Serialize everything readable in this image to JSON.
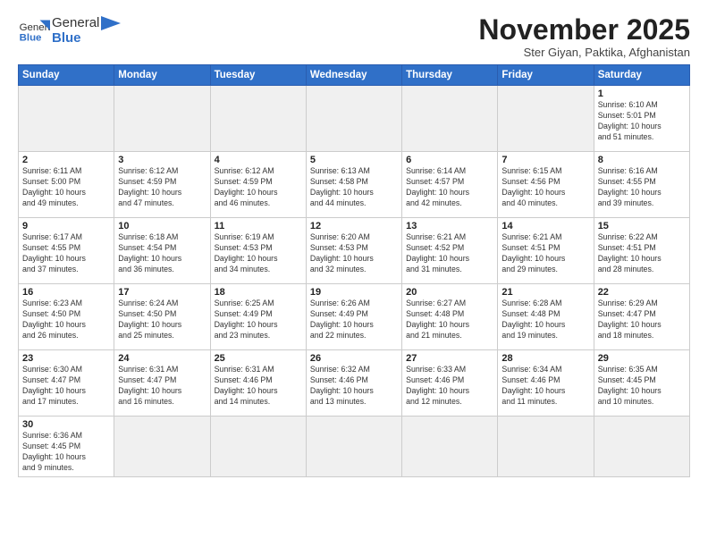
{
  "logo": {
    "text_general": "General",
    "text_blue": "Blue"
  },
  "header": {
    "month": "November 2025",
    "location": "Ster Giyan, Paktika, Afghanistan"
  },
  "weekdays": [
    "Sunday",
    "Monday",
    "Tuesday",
    "Wednesday",
    "Thursday",
    "Friday",
    "Saturday"
  ],
  "days": [
    {
      "num": "",
      "empty": true
    },
    {
      "num": "",
      "empty": true
    },
    {
      "num": "",
      "empty": true
    },
    {
      "num": "",
      "empty": true
    },
    {
      "num": "",
      "empty": true
    },
    {
      "num": "",
      "empty": true
    },
    {
      "num": "1",
      "sunrise": "6:10 AM",
      "sunset": "5:01 PM",
      "daylight": "10 hours and 51 minutes."
    },
    {
      "num": "2",
      "sunrise": "6:11 AM",
      "sunset": "5:00 PM",
      "daylight": "10 hours and 49 minutes."
    },
    {
      "num": "3",
      "sunrise": "6:12 AM",
      "sunset": "4:59 PM",
      "daylight": "10 hours and 47 minutes."
    },
    {
      "num": "4",
      "sunrise": "6:12 AM",
      "sunset": "4:59 PM",
      "daylight": "10 hours and 46 minutes."
    },
    {
      "num": "5",
      "sunrise": "6:13 AM",
      "sunset": "4:58 PM",
      "daylight": "10 hours and 44 minutes."
    },
    {
      "num": "6",
      "sunrise": "6:14 AM",
      "sunset": "4:57 PM",
      "daylight": "10 hours and 42 minutes."
    },
    {
      "num": "7",
      "sunrise": "6:15 AM",
      "sunset": "4:56 PM",
      "daylight": "10 hours and 40 minutes."
    },
    {
      "num": "8",
      "sunrise": "6:16 AM",
      "sunset": "4:55 PM",
      "daylight": "10 hours and 39 minutes."
    },
    {
      "num": "9",
      "sunrise": "6:17 AM",
      "sunset": "4:55 PM",
      "daylight": "10 hours and 37 minutes."
    },
    {
      "num": "10",
      "sunrise": "6:18 AM",
      "sunset": "4:54 PM",
      "daylight": "10 hours and 36 minutes."
    },
    {
      "num": "11",
      "sunrise": "6:19 AM",
      "sunset": "4:53 PM",
      "daylight": "10 hours and 34 minutes."
    },
    {
      "num": "12",
      "sunrise": "6:20 AM",
      "sunset": "4:53 PM",
      "daylight": "10 hours and 32 minutes."
    },
    {
      "num": "13",
      "sunrise": "6:21 AM",
      "sunset": "4:52 PM",
      "daylight": "10 hours and 31 minutes."
    },
    {
      "num": "14",
      "sunrise": "6:21 AM",
      "sunset": "4:51 PM",
      "daylight": "10 hours and 29 minutes."
    },
    {
      "num": "15",
      "sunrise": "6:22 AM",
      "sunset": "4:51 PM",
      "daylight": "10 hours and 28 minutes."
    },
    {
      "num": "16",
      "sunrise": "6:23 AM",
      "sunset": "4:50 PM",
      "daylight": "10 hours and 26 minutes."
    },
    {
      "num": "17",
      "sunrise": "6:24 AM",
      "sunset": "4:50 PM",
      "daylight": "10 hours and 25 minutes."
    },
    {
      "num": "18",
      "sunrise": "6:25 AM",
      "sunset": "4:49 PM",
      "daylight": "10 hours and 23 minutes."
    },
    {
      "num": "19",
      "sunrise": "6:26 AM",
      "sunset": "4:49 PM",
      "daylight": "10 hours and 22 minutes."
    },
    {
      "num": "20",
      "sunrise": "6:27 AM",
      "sunset": "4:48 PM",
      "daylight": "10 hours and 21 minutes."
    },
    {
      "num": "21",
      "sunrise": "6:28 AM",
      "sunset": "4:48 PM",
      "daylight": "10 hours and 19 minutes."
    },
    {
      "num": "22",
      "sunrise": "6:29 AM",
      "sunset": "4:47 PM",
      "daylight": "10 hours and 18 minutes."
    },
    {
      "num": "23",
      "sunrise": "6:30 AM",
      "sunset": "4:47 PM",
      "daylight": "10 hours and 17 minutes."
    },
    {
      "num": "24",
      "sunrise": "6:31 AM",
      "sunset": "4:47 PM",
      "daylight": "10 hours and 16 minutes."
    },
    {
      "num": "25",
      "sunrise": "6:31 AM",
      "sunset": "4:46 PM",
      "daylight": "10 hours and 14 minutes."
    },
    {
      "num": "26",
      "sunrise": "6:32 AM",
      "sunset": "4:46 PM",
      "daylight": "10 hours and 13 minutes."
    },
    {
      "num": "27",
      "sunrise": "6:33 AM",
      "sunset": "4:46 PM",
      "daylight": "10 hours and 12 minutes."
    },
    {
      "num": "28",
      "sunrise": "6:34 AM",
      "sunset": "4:46 PM",
      "daylight": "10 hours and 11 minutes."
    },
    {
      "num": "29",
      "sunrise": "6:35 AM",
      "sunset": "4:45 PM",
      "daylight": "10 hours and 10 minutes."
    },
    {
      "num": "30",
      "sunrise": "6:36 AM",
      "sunset": "4:45 PM",
      "daylight": "10 hours and 9 minutes."
    }
  ]
}
